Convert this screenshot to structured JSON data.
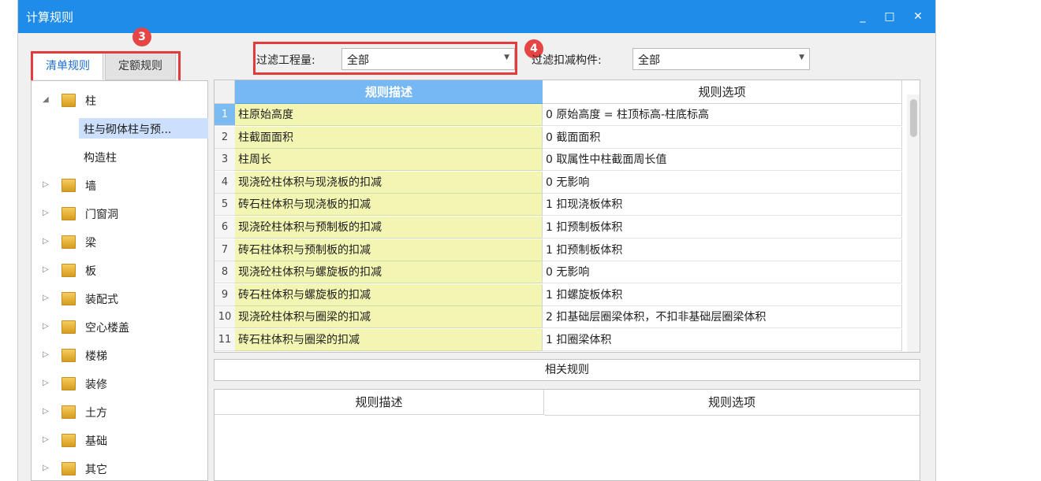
{
  "window": {
    "title": "计算规则",
    "minimize": "_",
    "maximize": "□",
    "close": "✕"
  },
  "tabs": [
    {
      "label": "清单规则"
    },
    {
      "label": "定额规则"
    }
  ],
  "badges": {
    "b3": "3",
    "b4": "4"
  },
  "filters": {
    "quantity": {
      "label": "过滤工程量:",
      "value": "全部"
    },
    "deduct": {
      "label": "过滤扣减构件:",
      "value": "全部"
    }
  },
  "tree": {
    "items": [
      {
        "label": "柱",
        "expanded": true,
        "children": [
          "柱与砌体柱与预...",
          "构造柱"
        ]
      },
      {
        "label": "墙"
      },
      {
        "label": "门窗洞"
      },
      {
        "label": "梁"
      },
      {
        "label": "板"
      },
      {
        "label": "装配式"
      },
      {
        "label": "空心楼盖"
      },
      {
        "label": "楼梯"
      },
      {
        "label": "装修"
      },
      {
        "label": "土方"
      },
      {
        "label": "基础"
      },
      {
        "label": "其它"
      }
    ]
  },
  "rules_grid": {
    "headers": [
      "规则描述",
      "规则选项"
    ],
    "rows": [
      {
        "n": "1",
        "desc": "柱原始高度",
        "opt": "0 原始高度 = 柱顶标高-柱底标高"
      },
      {
        "n": "2",
        "desc": "柱截面面积",
        "opt": "0 截面面积"
      },
      {
        "n": "3",
        "desc": "柱周长",
        "opt": "0 取属性中柱截面周长值"
      },
      {
        "n": "4",
        "desc": "现浇砼柱体积与现浇板的扣减",
        "opt": "0  无影响"
      },
      {
        "n": "5",
        "desc": "砖石柱体积与现浇板的扣减",
        "opt": "1 扣现浇板体积"
      },
      {
        "n": "6",
        "desc": "现浇砼柱体积与预制板的扣减",
        "opt": "1 扣预制板体积"
      },
      {
        "n": "7",
        "desc": "砖石柱体积与预制板的扣减",
        "opt": "1 扣预制板体积"
      },
      {
        "n": "8",
        "desc": "现浇砼柱体积与螺旋板的扣减",
        "opt": "0  无影响"
      },
      {
        "n": "9",
        "desc": "砖石柱体积与螺旋板的扣减",
        "opt": "1 扣螺旋板体积"
      },
      {
        "n": "10",
        "desc": "现浇砼柱体积与圈梁的扣减",
        "opt": "2 扣基础层圈梁体积，不扣非基础层圈梁体积"
      },
      {
        "n": "11",
        "desc": "砖石柱体积与圈梁的扣减",
        "opt": "1 扣圈梁体积"
      }
    ]
  },
  "related": {
    "title": "相关规则",
    "headers": [
      "规则描述",
      "规则选项"
    ]
  }
}
